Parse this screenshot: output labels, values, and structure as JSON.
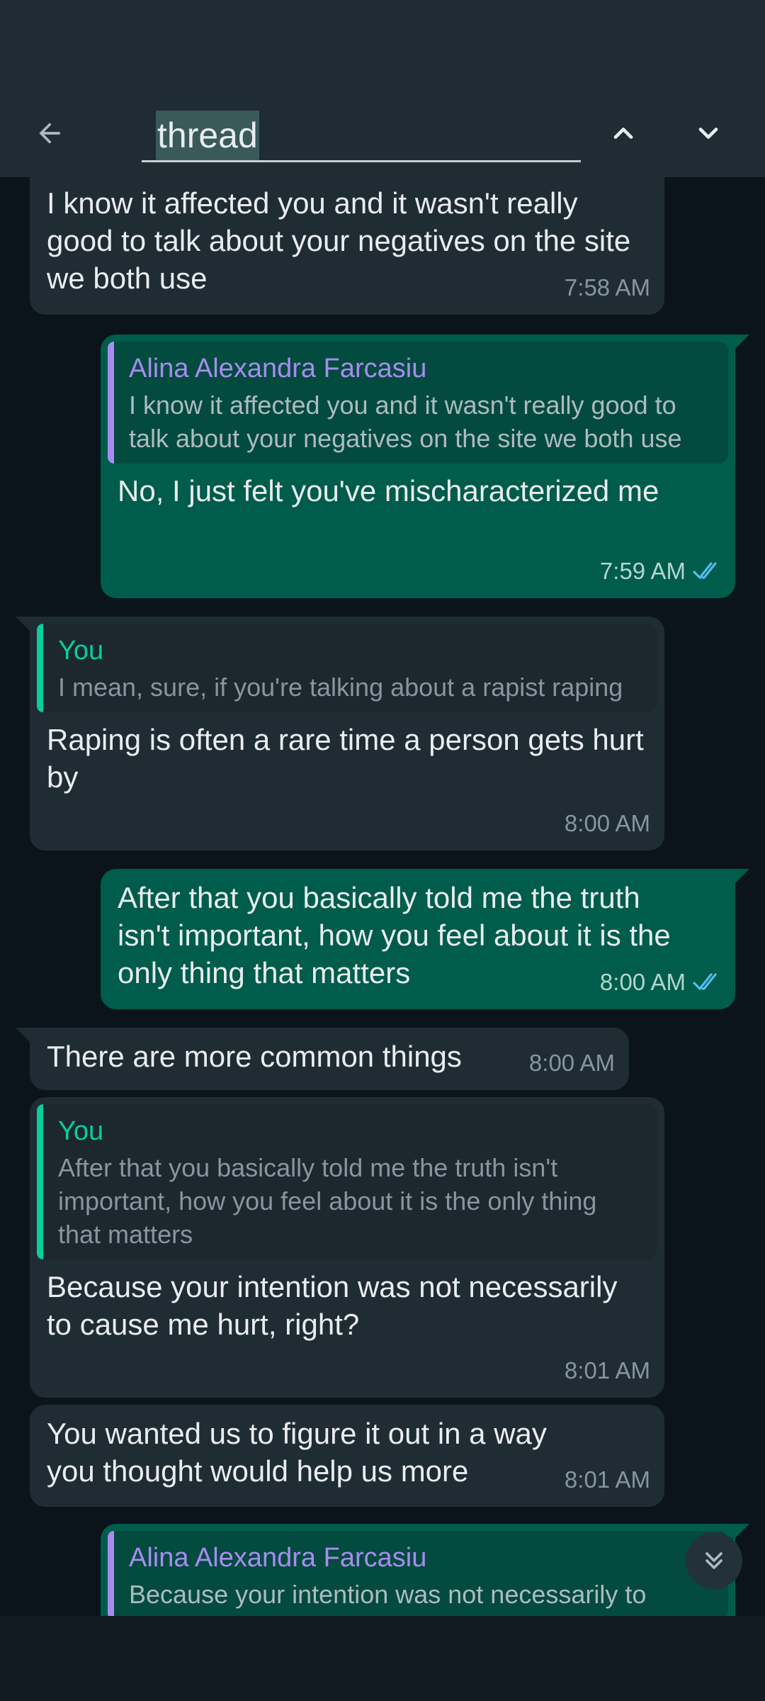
{
  "search": {
    "query": "thread"
  },
  "messages": [
    {
      "dir": "in",
      "text": "I know it affected you and it wasn't really good to talk about your negatives on the site we both use",
      "time": "7:58 AM"
    },
    {
      "dir": "out",
      "quote_author": "Alina Alexandra Farcasiu",
      "quote_text": "I know it affected you and it wasn't really good to talk about your negatives on the site we both use",
      "text": "No, I just felt you've mischaracterized me",
      "time": "7:59 AM"
    },
    {
      "dir": "in",
      "quote_author": "You",
      "quote_text": "I mean, sure, if you're talking about a rapist raping",
      "text": "Raping is often a rare time a person gets hurt by",
      "time": "8:00 AM"
    },
    {
      "dir": "out",
      "text": "After that you basically told me the truth isn't important, how you feel about it is the only thing that matters",
      "time": "8:00 AM"
    },
    {
      "dir": "in",
      "text": "There are more common things",
      "time": "8:00 AM"
    },
    {
      "dir": "in",
      "quote_author": "You",
      "quote_text": "After that you basically told me the truth isn't important, how you feel about it is the only thing that matters",
      "text": "Because your intention was not necessarily to cause me hurt, right?",
      "time": "8:01 AM"
    },
    {
      "dir": "in",
      "text": "You wanted us to figure it out in a way you thought would help us more",
      "time": "8:01 AM"
    },
    {
      "dir": "out",
      "quote_author": "Alina Alexandra Farcasiu",
      "quote_text": "Because your intention was not necessarily to"
    }
  ],
  "icons": {
    "back": "arrow-left-icon",
    "prev": "chevron-up-icon",
    "next": "chevron-down-icon",
    "scroll_down": "double-chevron-down-icon",
    "read_receipt": "double-check-icon"
  },
  "colors": {
    "incoming_bubble": "#202c33",
    "outgoing_bubble": "#005c4b",
    "accent_green": "#06cf9c",
    "quote_purple": "#a88bf0",
    "read_tick": "#53bdeb"
  }
}
